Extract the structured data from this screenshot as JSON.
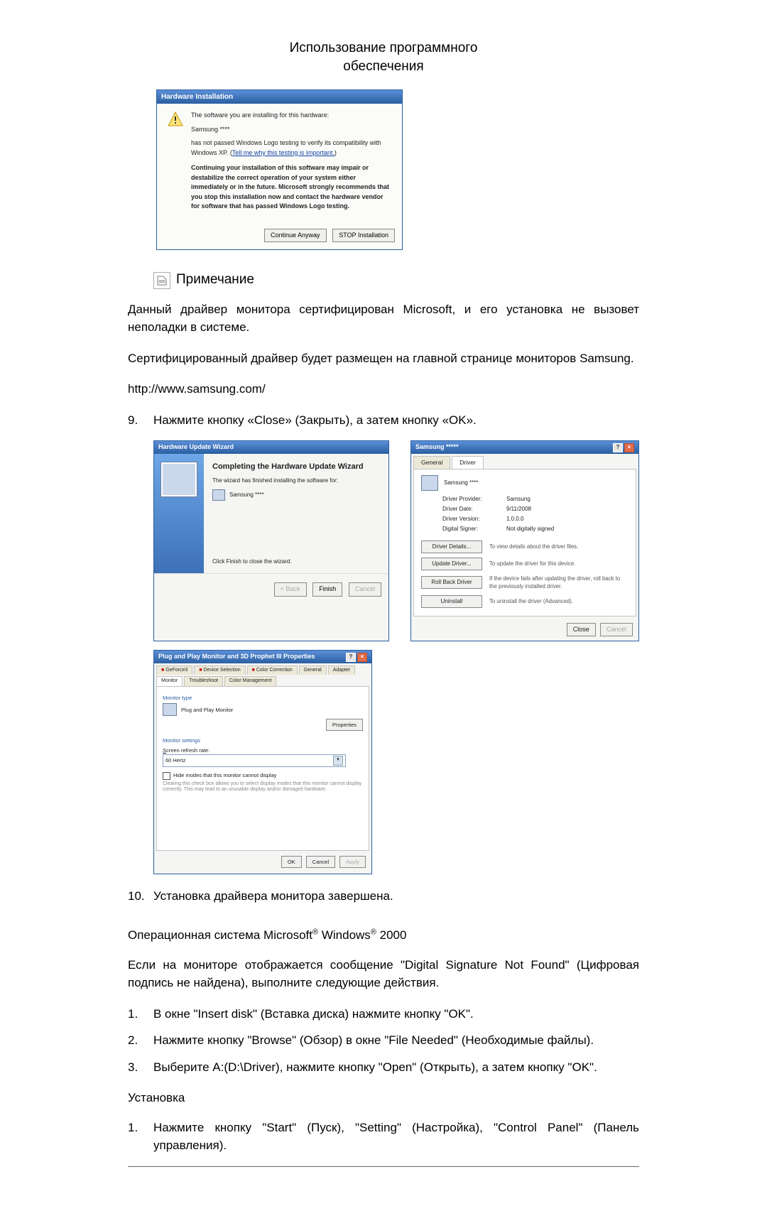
{
  "header": {
    "line1": "Использование программного",
    "line2": "обеспечения"
  },
  "dialog1": {
    "title": "Hardware Installation",
    "l1": "The software you are installing for this hardware:",
    "l2": "Samsung ****",
    "l3a": "has not passed Windows Logo testing to verify its compatibility with Windows XP. (",
    "l3link": "Tell me why this testing is important.",
    "l3b": ")",
    "bold": "Continuing your installation of this software may impair or destabilize the correct operation of your system either immediately or in the future. Microsoft strongly recommends that you stop this installation now and contact the hardware vendor for software that has passed Windows Logo testing.",
    "btn1": "Continue Anyway",
    "btn2": "STOP Installation"
  },
  "note": {
    "label": "Примечание",
    "p1": "Данный драйвер монитора сертифицирован Microsoft, и его установка не вызовет неполадки в системе.",
    "p2": "Сертифицированный  драйвер  будет  размещен  на  главной  странице  мониторов Samsung.",
    "url": "http://www.samsung.com/"
  },
  "steps": {
    "s9": {
      "n": "9.",
      "t": "Нажмите кнопку «Close» (Закрыть), а затем кнопку «OK»."
    },
    "s10": {
      "n": "10.",
      "t": "Установка драйвера монитора завершена."
    }
  },
  "wizard": {
    "title": "Hardware Update Wizard",
    "h": "Completing the Hardware Update Wizard",
    "p1": "The wizard has finished installing the software for:",
    "dev": "Samsung ****",
    "p2": "Click Finish to close the wizard.",
    "back": "< Back",
    "finish": "Finish",
    "cancel": "Cancel"
  },
  "props": {
    "title": "Samsung *****",
    "tab1": "General",
    "tab2": "Driver",
    "dev": "Samsung ****",
    "k1": "Driver Provider:",
    "v1": "Samsung",
    "k2": "Driver Date:",
    "v2": "9/11/2008",
    "k3": "Driver Version:",
    "v3": "1.0.0.0",
    "k4": "Digital Signer:",
    "v4": "Not digitally signed",
    "b1": "Driver Details...",
    "d1": "To view details about the driver files.",
    "b2": "Update Driver...",
    "d2": "To update the driver for this device.",
    "b3": "Roll Back Driver",
    "d3": "If the device fails after updating the driver, roll back to the previously installed driver.",
    "b4": "Uninstall",
    "d4": "To uninstall the driver (Advanced).",
    "close": "Close",
    "cancel": "Cancel"
  },
  "monprops": {
    "title": "Plug and Play Monitor and 3D Prophet III Properties",
    "tabs": [
      "GeForce3",
      "Device Selection",
      "Color Correction",
      "General",
      "Adapter",
      "Monitor",
      "Troubleshoot",
      "Color Management"
    ],
    "activeTab": "Monitor",
    "sec1": "Monitor type",
    "dev": "Plug and Play Monitor",
    "propsBtn": "Properties",
    "sec2": "Monitor settings",
    "rateLbl": "Screen refresh rate:",
    "rateVal": "60 Hertz",
    "chk": "Hide modes that this monitor cannot display",
    "fine": "Clearing this check box allows you to select display modes that this monitor cannot display correctly. This may lead to an unusable display and/or damaged hardware.",
    "ok": "OK",
    "cancel": "Cancel",
    "apply": "Apply"
  },
  "win2000": {
    "ostitle_a": "Операционная система Microsoft",
    "ostitle_b": " Windows",
    "ostitle_c": " 2000",
    "p": "Если на мониторе отображается сообщение \"Digital Signature Not Found\" (Цифровая подпись не найдена), выполните следующие действия.",
    "s1": {
      "n": "1.",
      "t": "В окне \"Insert disk\" (Вставка диска) нажмите кнопку \"OK\"."
    },
    "s2": {
      "n": "2.",
      "t": "Нажмите кнопку \"Browse\" (Обзор) в окне \"File Needed\" (Необходимые файлы)."
    },
    "s3": {
      "n": "3.",
      "t": "Выберите A:(D:\\Driver), нажмите кнопку \"Open\" (Открыть), а затем кнопку \"OK\"."
    },
    "install": "Установка",
    "i1": {
      "n": "1.",
      "t": "Нажмите  кнопку  \"Start\"  (Пуск),  \"Setting\"  (Настройка),  \"Control  Panel\"  (Панель управления)."
    }
  }
}
